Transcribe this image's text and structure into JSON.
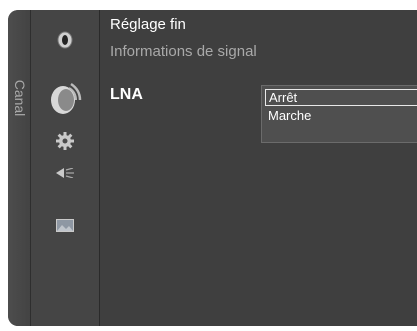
{
  "sidebar": {
    "label": "Canal"
  },
  "icons": [
    {
      "name": "input-icon"
    },
    {
      "name": "satellite-dish-icon"
    },
    {
      "name": "gear-icon"
    },
    {
      "name": "sound-icon"
    },
    {
      "name": "picture-icon"
    }
  ],
  "menu": {
    "items": [
      {
        "label": "Réglage fin"
      },
      {
        "label": "Informations de signal"
      },
      {
        "label": "LNA"
      }
    ]
  },
  "dropdown": {
    "options": [
      {
        "label": "Arrêt",
        "selected": true
      },
      {
        "label": "Marche",
        "selected": false
      }
    ]
  },
  "colors": {
    "background": "#3f3f3f",
    "text": "#ffffff",
    "dim_text": "#a9a9a9"
  }
}
